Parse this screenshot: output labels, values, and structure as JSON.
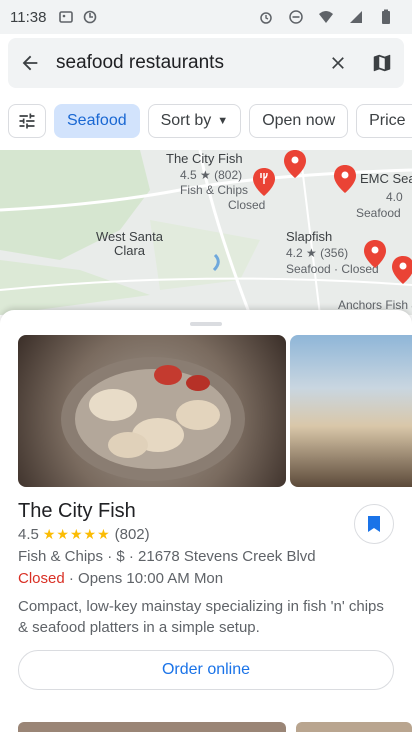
{
  "status_bar": {
    "time": "11:38"
  },
  "search": {
    "query": "seafood restaurants"
  },
  "chips": [
    {
      "label": "Seafood",
      "selected": true,
      "has_caret": false
    },
    {
      "label": "Sort by",
      "selected": false,
      "has_caret": true
    },
    {
      "label": "Open now",
      "selected": false,
      "has_caret": false
    },
    {
      "label": "Price",
      "selected": false,
      "has_caret": true
    }
  ],
  "map": {
    "labels": {
      "city_fish_name": "The City Fish",
      "city_fish_rating": "4.5 ★ (802)",
      "city_fish_cat": "Fish & Chips",
      "city_fish_status": "Closed",
      "area": "West Santa\nClara",
      "slapfish_name": "Slapfish",
      "slapfish_rating": "4.2 ★ (356)",
      "slapfish_status": "Seafood · Closed",
      "emc_name": "EMC Seafood & Ra",
      "emc_rating": "4.0",
      "emc_cat": "Seafood",
      "anchors": "Anchors Fish & Ch"
    }
  },
  "place": {
    "name": "The City Fish",
    "rating": "4.5",
    "stars": "★★★★★",
    "reviews": "(802)",
    "details": "Fish & Chips · $ · 21678 Stevens Creek Blvd",
    "status": "Closed",
    "opens": " · Opens 10:00 AM Mon",
    "description": "Compact, low-key mainstay specializing in fish 'n' chips & seafood platters in a simple setup.",
    "order_label": "Order online"
  },
  "colors": {
    "accent": "#1a73e8",
    "closed": "#d93025",
    "pin": "#ea4335",
    "chip_selected_bg": "#d2e3fc"
  }
}
